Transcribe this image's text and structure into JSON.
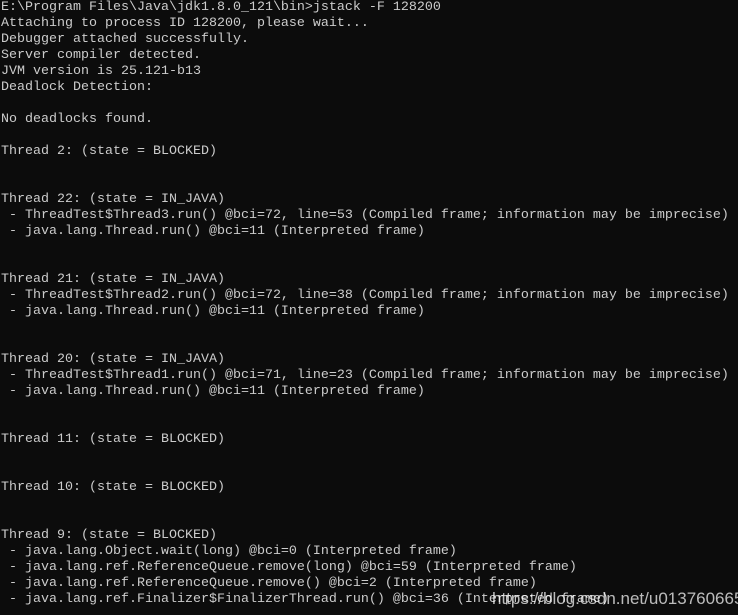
{
  "console": {
    "lines": [
      "E:\\Program Files\\Java\\jdk1.8.0_121\\bin>jstack -F 128200",
      "Attaching to process ID 128200, please wait...",
      "Debugger attached successfully.",
      "Server compiler detected.",
      "JVM version is 25.121-b13",
      "Deadlock Detection:",
      "",
      "No deadlocks found.",
      "",
      "Thread 2: (state = BLOCKED)",
      "",
      "",
      "Thread 22: (state = IN_JAVA)",
      " - ThreadTest$Thread3.run() @bci=72, line=53 (Compiled frame; information may be imprecise)",
      " - java.lang.Thread.run() @bci=11 (Interpreted frame)",
      "",
      "",
      "Thread 21: (state = IN_JAVA)",
      " - ThreadTest$Thread2.run() @bci=72, line=38 (Compiled frame; information may be imprecise)",
      " - java.lang.Thread.run() @bci=11 (Interpreted frame)",
      "",
      "",
      "Thread 20: (state = IN_JAVA)",
      " - ThreadTest$Thread1.run() @bci=71, line=23 (Compiled frame; information may be imprecise)",
      " - java.lang.Thread.run() @bci=11 (Interpreted frame)",
      "",
      "",
      "Thread 11: (state = BLOCKED)",
      "",
      "",
      "Thread 10: (state = BLOCKED)",
      "",
      "",
      "Thread 9: (state = BLOCKED)",
      " - java.lang.Object.wait(long) @bci=0 (Interpreted frame)",
      " - java.lang.ref.ReferenceQueue.remove(long) @bci=59 (Interpreted frame)",
      " - java.lang.ref.ReferenceQueue.remove() @bci=2 (Interpreted frame)",
      " - java.lang.ref.Finalizer$FinalizerThread.run() @bci=36 (Interpreted frame)"
    ]
  },
  "watermark": "https://blog.csdn.net/u013760665",
  "colors": {
    "background": "#0c0c0c",
    "text": "#cccccc"
  }
}
